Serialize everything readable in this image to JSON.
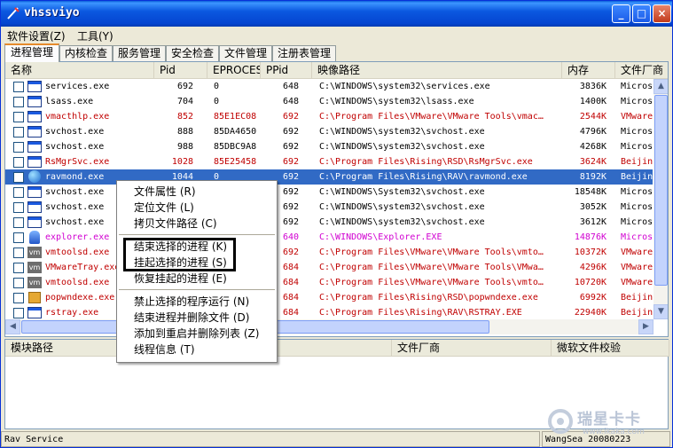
{
  "window": {
    "title": "vhssviyo",
    "controls": [
      "_",
      "□",
      "×"
    ]
  },
  "menu": [
    "软件设置(Z)",
    "工具(Y)"
  ],
  "tabs": [
    "进程管理",
    "内核检查",
    "服务管理",
    "安全检查",
    "文件管理",
    "注册表管理"
  ],
  "columns": [
    "名称",
    "Pid",
    "EPROCESS",
    "PPid",
    "映像路径",
    "内存",
    "文件厂商"
  ],
  "rows": [
    {
      "name": "services.exe",
      "pid": "692",
      "eprocess": "0",
      "ppid": "648",
      "path": "C:\\WINDOWS\\system32\\services.exe",
      "mem": "3836K",
      "vendor": "Micros",
      "style": "normal",
      "icon": "window-icon"
    },
    {
      "name": "lsass.exe",
      "pid": "704",
      "eprocess": "0",
      "ppid": "648",
      "path": "C:\\WINDOWS\\system32\\lsass.exe",
      "mem": "1400K",
      "vendor": "Micros",
      "style": "normal",
      "icon": "window-icon"
    },
    {
      "name": "vmacthlp.exe",
      "pid": "852",
      "eprocess": "85E1EC08",
      "ppid": "692",
      "path": "C:\\Program Files\\VMware\\VMware Tools\\vmac…",
      "mem": "2544K",
      "vendor": "VMware,",
      "style": "red",
      "icon": "window-icon"
    },
    {
      "name": "svchost.exe",
      "pid": "888",
      "eprocess": "85DA4650",
      "ppid": "692",
      "path": "C:\\WINDOWS\\system32\\svchost.exe",
      "mem": "4796K",
      "vendor": "Micros",
      "style": "normal",
      "icon": "window-icon"
    },
    {
      "name": "svchost.exe",
      "pid": "988",
      "eprocess": "85DBC9A8",
      "ppid": "692",
      "path": "C:\\WINDOWS\\system32\\svchost.exe",
      "mem": "4268K",
      "vendor": "Micros",
      "style": "normal",
      "icon": "window-icon"
    },
    {
      "name": "RsMgrSvc.exe",
      "pid": "1028",
      "eprocess": "85E25458",
      "ppid": "692",
      "path": "C:\\Program Files\\Rising\\RSD\\RsMgrSvc.exe",
      "mem": "3624K",
      "vendor": "Beijing",
      "style": "red",
      "icon": "window-icon"
    },
    {
      "name": "ravmond.exe",
      "pid": "1044",
      "eprocess": "0",
      "ppid": "692",
      "path": "C:\\Program Files\\Rising\\RAV\\ravmond.exe",
      "mem": "8192K",
      "vendor": "Beijing",
      "style": "sel",
      "icon": "globe-icon"
    },
    {
      "name": "svchost.exe",
      "pid": "",
      "eprocess": "",
      "ppid": "692",
      "path": "C:\\WINDOWS\\System32\\svchost.exe",
      "mem": "18548K",
      "vendor": "Micros",
      "style": "normal",
      "icon": "window-icon"
    },
    {
      "name": "svchost.exe",
      "pid": "",
      "eprocess": "",
      "ppid": "692",
      "path": "C:\\WINDOWS\\system32\\svchost.exe",
      "mem": "3052K",
      "vendor": "Micros",
      "style": "normal",
      "icon": "window-icon"
    },
    {
      "name": "svchost.exe",
      "pid": "",
      "eprocess": "",
      "ppid": "692",
      "path": "C:\\WINDOWS\\system32\\svchost.exe",
      "mem": "3612K",
      "vendor": "Micros",
      "style": "normal",
      "icon": "window-icon"
    },
    {
      "name": "explorer.exe",
      "pid": "",
      "eprocess": "",
      "ppid": "640",
      "path": "C:\\WINDOWS\\Explorer.EXE",
      "mem": "14876K",
      "vendor": "Micros",
      "style": "magenta",
      "icon": "explorer-icon"
    },
    {
      "name": "vmtoolsd.exe",
      "pid": "",
      "eprocess": "",
      "ppid": "692",
      "path": "C:\\Program Files\\VMware\\VMware Tools\\vmto…",
      "mem": "10372K",
      "vendor": "VMware,",
      "style": "red",
      "icon": "vm-icon"
    },
    {
      "name": "VMwareTray.exe",
      "pid": "",
      "eprocess": "",
      "ppid": "684",
      "path": "C:\\Program Files\\VMware\\VMware Tools\\VMwa…",
      "mem": "4296K",
      "vendor": "VMware,",
      "style": "red",
      "icon": "vm-icon"
    },
    {
      "name": "vmtoolsd.exe",
      "pid": "",
      "eprocess": "",
      "ppid": "684",
      "path": "C:\\Program Files\\VMware\\VMware Tools\\vmto…",
      "mem": "10720K",
      "vendor": "VMware,",
      "style": "red",
      "icon": "vm-icon"
    },
    {
      "name": "popwndexe.exe",
      "pid": "",
      "eprocess": "",
      "ppid": "684",
      "path": "C:\\Program Files\\Rising\\RSD\\popwndexe.exe",
      "mem": "6992K",
      "vendor": "Beijing",
      "style": "red",
      "icon": "box-icon"
    },
    {
      "name": "rstray.exe",
      "pid": "",
      "eprocess": "",
      "ppid": "684",
      "path": "C:\\Program Files\\Rising\\RAV\\RSTRAY.EXE",
      "mem": "22940K",
      "vendor": "Beijing",
      "style": "red",
      "icon": "window-icon"
    }
  ],
  "module_columns": [
    "模块路径",
    "文件厂商",
    "微软文件校验"
  ],
  "context_menu": [
    {
      "label": "文件属性 (R)",
      "sep_after": false
    },
    {
      "label": "定位文件 (L)",
      "sep_after": false
    },
    {
      "label": "拷贝文件路径 (C)",
      "sep_after": true
    },
    {
      "label": "结束选择的进程 (K)",
      "sep_after": false
    },
    {
      "label": "挂起选择的进程 (S)",
      "sep_after": false
    },
    {
      "label": "恢复挂起的进程 (E)",
      "sep_after": true
    },
    {
      "label": "禁止选择的程序运行 (N)",
      "sep_after": false
    },
    {
      "label": "结束进程并删除文件 (D)",
      "sep_after": false
    },
    {
      "label": "添加到重启并删除列表 (Z)",
      "sep_after": false
    },
    {
      "label": "线程信息 (T)",
      "sep_after": false
    }
  ],
  "status": {
    "left": "Rav Service",
    "right": "WangSea 20080223"
  },
  "watermark": {
    "text": "瑞星卡卡",
    "url": "www.ikaka.com"
  },
  "colors": {
    "titlebar": "#0545d0",
    "selected_row": "#316ac5",
    "red_text": "#c00000",
    "magenta_text": "#d100d1"
  }
}
